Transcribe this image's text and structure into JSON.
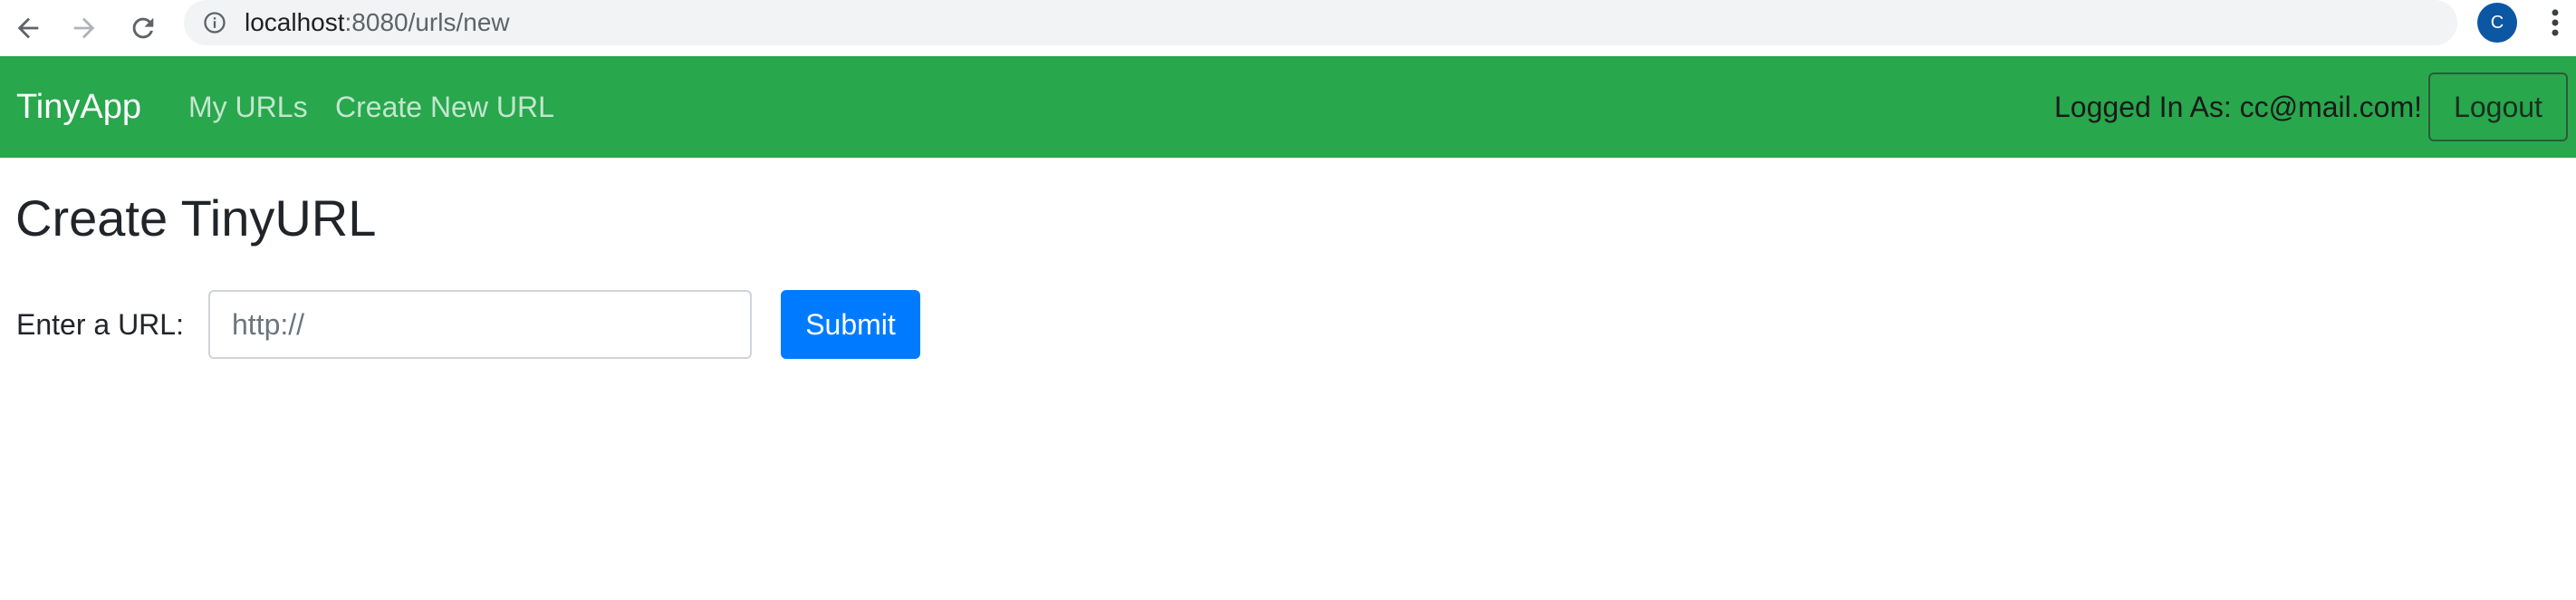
{
  "browser": {
    "url_host": "localhost",
    "url_rest": ":8080/urls/new",
    "profile_initial": "C",
    "icons": {
      "back": "arrow-left-icon",
      "forward": "arrow-right-icon",
      "reload": "reload-icon",
      "info": "info-icon",
      "bookmark": "star-icon",
      "menu": "kebab-menu-icon"
    }
  },
  "navbar": {
    "brand": "TinyApp",
    "links": [
      "My URLs",
      "Create New URL"
    ],
    "logged_in_text": "Logged In As: cc@mail.com!",
    "logout_label": "Logout",
    "background_color": "#28a74d"
  },
  "main": {
    "title": "Create TinyURL",
    "form": {
      "label": "Enter a URL:",
      "input_placeholder": "http://",
      "input_value": "",
      "submit_label": "Submit",
      "submit_color": "#007bff"
    }
  }
}
